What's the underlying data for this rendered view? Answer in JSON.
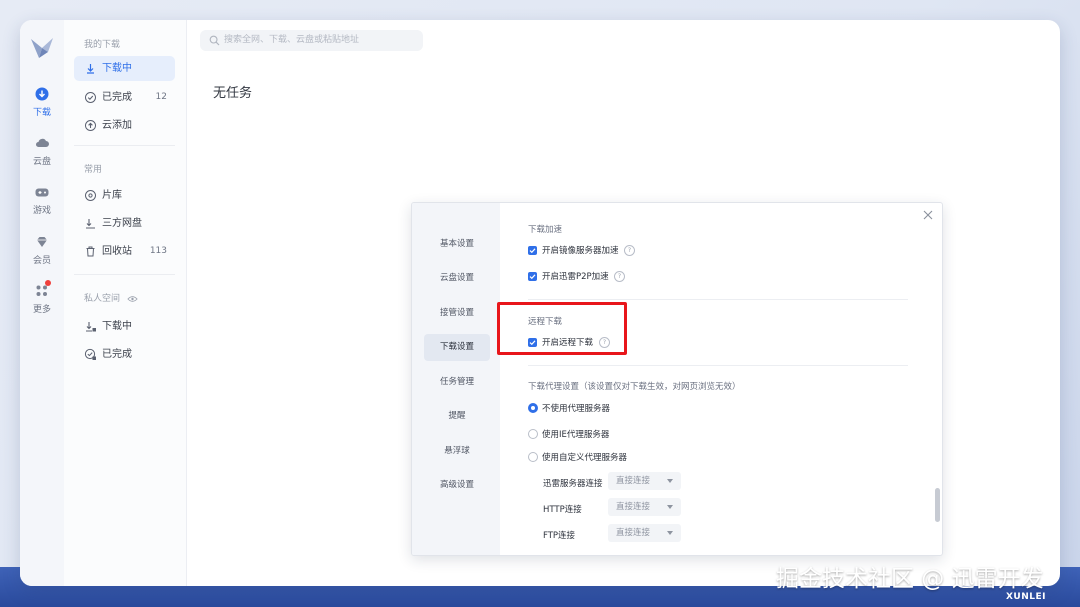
{
  "search": {
    "placeholder": "搜索全网、下载、云盘或粘贴地址"
  },
  "rail": [
    {
      "label": "下载",
      "icon": "download-circle-icon",
      "active": true
    },
    {
      "label": "云盘",
      "icon": "cloud-icon"
    },
    {
      "label": "游戏",
      "icon": "gamepad-icon"
    },
    {
      "label": "会员",
      "icon": "diamond-icon"
    },
    {
      "label": "更多",
      "icon": "apps-grid-icon",
      "badge": true
    }
  ],
  "sidebar": {
    "my_downloads_title": "我的下载",
    "downloading": "下载中",
    "completed": "已完成",
    "completed_count": "12",
    "cloud_add": "云添加",
    "common_title": "常用",
    "library": "片库",
    "third_party": "三方网盘",
    "recycle": "回收站",
    "recycle_count": "113",
    "private_title": "私人空间",
    "private_downloading": "下载中",
    "private_completed": "已完成"
  },
  "main": {
    "empty_text": "无任务"
  },
  "dialog": {
    "nav": [
      "基本设置",
      "云盘设置",
      "接管设置",
      "下载设置",
      "任务管理",
      "提醒",
      "悬浮球",
      "高级设置"
    ],
    "active_nav": "下载设置",
    "accel_title": "下载加速",
    "mirror_accel": "开启镜像服务器加速",
    "p2p_accel": "开启迅雷P2P加速",
    "remote_title": "远程下载",
    "remote_enable": "开启远程下载",
    "proxy_title": "下载代理设置（该设置仅对下载生效，对网页浏览无效）",
    "proxy_none": "不使用代理服务器",
    "proxy_ie": "使用IE代理服务器",
    "proxy_custom": "使用自定义代理服务器",
    "xunlei_conn": "迅雷服务器连接",
    "http_conn": "HTTP连接",
    "ftp_conn": "FTP连接",
    "direct": "直接连接"
  },
  "watermark": "掘金技术社区 @ 迅雷开发",
  "brand": "XUNLEI",
  "colors": {
    "accent": "#2f6fe8",
    "highlight": "#e8161b",
    "band": "#2a4a9c"
  }
}
